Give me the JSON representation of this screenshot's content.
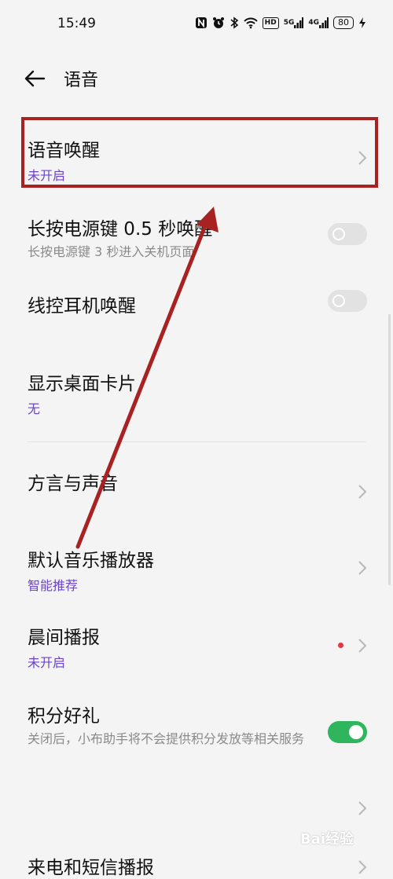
{
  "status_bar": {
    "time": "15:49",
    "icons": [
      "nfc-icon",
      "alarm-icon",
      "bluetooth-icon",
      "wifi-icon",
      "hd-icon",
      "signal-5g-icon",
      "signal-4g-icon",
      "battery-icon",
      "charging-icon"
    ],
    "hd_label": "HD",
    "sig1_label": "5G",
    "sig2_label": "4G",
    "battery": "80"
  },
  "header": {
    "title": "语音"
  },
  "settings": {
    "voice_wake": {
      "title": "语音唤醒",
      "subtitle": "未开启"
    },
    "power_key": {
      "title": "长按电源键 0.5 秒唤醒",
      "subtitle": "长按电源键 3 秒进入关机页面",
      "toggle_on": false
    },
    "headset": {
      "title": "线控耳机唤醒",
      "toggle_on": false
    },
    "desktop_card": {
      "title": "显示桌面卡片",
      "subtitle": "无"
    },
    "dialect": {
      "title": "方言与声音"
    },
    "music_player": {
      "title": "默认音乐播放器",
      "subtitle": "智能推荐"
    },
    "morning": {
      "title": "晨间播报",
      "subtitle": "未开启"
    },
    "points": {
      "title": "积分好礼",
      "subtitle": "关闭后，小布助手将不会提供积分发放等相关服务",
      "toggle_on": true
    },
    "calls": {
      "title": "来电和短信播报"
    }
  },
  "annotation": {
    "highlight_color": "#a82222",
    "arrow_color": "#a82222"
  },
  "colors": {
    "accent_purple": "#6c44c8",
    "toggle_on": "#2fb55d",
    "toggle_off": "#e2e2e2",
    "background": "#f4f4f4"
  },
  "watermark": "Bai经验"
}
